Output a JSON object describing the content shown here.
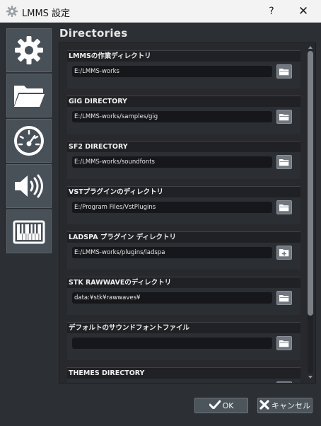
{
  "window": {
    "title": "LMMS 設定",
    "help_label": "?",
    "close_label": "✕"
  },
  "nav": {
    "items": [
      {
        "icon": "gear-icon"
      },
      {
        "icon": "folder-icon"
      },
      {
        "icon": "gauge-icon"
      },
      {
        "icon": "speaker-icon"
      },
      {
        "icon": "midi-keyboard-icon"
      }
    ]
  },
  "section": {
    "title": "Directories"
  },
  "directories": [
    {
      "label": "LMMSの作業ディレクトリ",
      "value": "E:/LMMS-works",
      "button_icon": "folder-icon"
    },
    {
      "label": "GIG DIRECTORY",
      "value": "E:/LMMS-works/samples/gig",
      "button_icon": "folder-icon"
    },
    {
      "label": "SF2 DIRECTORY",
      "value": "E:/LMMS-works/soundfonts",
      "button_icon": "folder-icon"
    },
    {
      "label": "VSTプラグインのディレクトリ",
      "value": "E:/Program Files/VstPlugins",
      "button_icon": "folder-icon"
    },
    {
      "label": "LADSPA プラグイン ディレクトリ",
      "value": "E:/LMMS-works/plugins/ladspa",
      "button_icon": "add-folder-icon"
    },
    {
      "label": "STK RAWWAVEのディレクトリ",
      "value": "data:¥stk¥rawwaves¥",
      "button_icon": "folder-icon"
    },
    {
      "label": "デフォルトのサウンドフォントファイル",
      "value": "",
      "button_icon": "folder-icon"
    },
    {
      "label": "THEMES DIRECTORY",
      "value": "",
      "button_icon": "folder-icon"
    }
  ],
  "buttons": {
    "ok_label": "OK",
    "cancel_label": "キャンセル"
  },
  "colors": {
    "window_bg": "#2c2f33",
    "panel_bg": "#27292d",
    "field_bg": "#15171a",
    "nav_bg": "#485058"
  }
}
